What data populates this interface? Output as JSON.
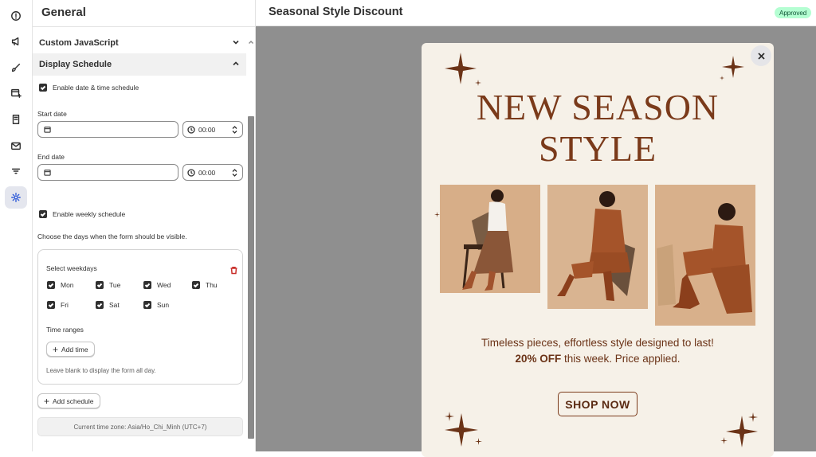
{
  "rail": {
    "items": [
      {
        "icon": "info-icon"
      },
      {
        "icon": "megaphone-icon"
      },
      {
        "icon": "brush-icon"
      },
      {
        "icon": "form-add-icon"
      },
      {
        "icon": "book-icon"
      },
      {
        "icon": "mail-icon"
      },
      {
        "icon": "filter-icon"
      },
      {
        "icon": "gear-icon",
        "active": true
      }
    ]
  },
  "panel": {
    "title": "General",
    "sections": {
      "custom_js": "Custom JavaScript",
      "display_schedule": "Display Schedule"
    },
    "enable_datetime": "Enable date & time schedule",
    "start_date": {
      "label": "Start date",
      "value": "",
      "time": "00:00"
    },
    "end_date": {
      "label": "End date",
      "value": "",
      "time": "00:00"
    },
    "enable_weekly": "Enable weekly schedule",
    "weekly_help": "Choose the days when the form should be visible.",
    "weekdays": {
      "label": "Select weekdays",
      "days": [
        "Mon",
        "Tue",
        "Wed",
        "Thu",
        "Fri",
        "Sat",
        "Sun"
      ]
    },
    "time_ranges": {
      "label": "Time ranges",
      "add_label": "Add time",
      "hint": "Leave blank to display the form all day."
    },
    "add_schedule_label": "Add schedule",
    "timezone": "Current time zone:  Asia/Ho_Chi_Minh (UTC+7)"
  },
  "main": {
    "title": "Seasonal Style Discount",
    "status": "Approved",
    "popup": {
      "headline_line1": "NEW SEASON",
      "headline_line2": "STYLE",
      "tagline": "Timeless pieces, effortless style designed to last!",
      "offer_bold": "20% OFF",
      "offer_rest": " this week. Price applied.",
      "cta": "SHOP NOW"
    }
  },
  "colors": {
    "accent": "#2f5bd8",
    "badge_bg": "#b4fed2",
    "popup_bg": "#f6f1e8",
    "brand_brown": "#7a3a1a",
    "canvas": "#8f8f8f"
  }
}
